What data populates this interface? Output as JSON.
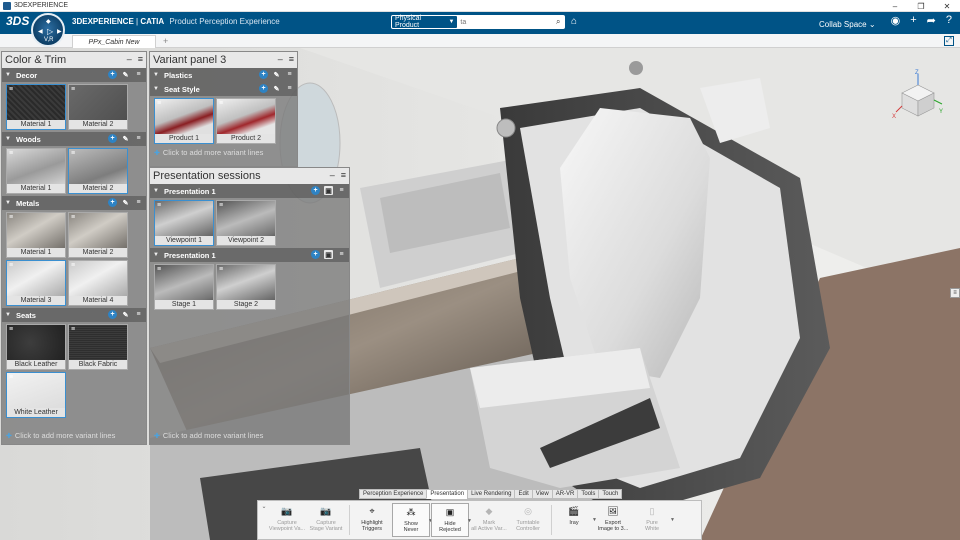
{
  "window": {
    "title": "3DEXPERIENCE",
    "controls": [
      "–",
      "❐",
      "✕"
    ]
  },
  "topbar": {
    "brand_bold": "3DEXPERIENCE",
    "brand_sep": " | ",
    "brand_catia": "CATIA",
    "brand_app": "Product Perception Experience",
    "compass_label": "V,R",
    "search_scope": "Physical Product",
    "search_placeholder": "ta",
    "collab_space": "Collab Space",
    "icons": [
      "user-icon",
      "plus-icon",
      "share-icon",
      "help-icon"
    ]
  },
  "tabs": {
    "doc_tab": "PPx_Cabin New",
    "add": "+"
  },
  "color_trim": {
    "title": "Color & Trim",
    "sections": [
      {
        "name": "Decor",
        "items": [
          {
            "label": "Material 1",
            "swatch": "sw-dark",
            "selected": true
          },
          {
            "label": "Material 2",
            "swatch": "sw-grey"
          }
        ]
      },
      {
        "name": "Woods",
        "items": [
          {
            "label": "Material 1",
            "swatch": "sw-wood1"
          },
          {
            "label": "Material 2",
            "swatch": "sw-wood2",
            "selected": true
          }
        ]
      },
      {
        "name": "Metals",
        "items": [
          {
            "label": "Material 1",
            "swatch": "sw-metal"
          },
          {
            "label": "Material 2",
            "swatch": "sw-metal"
          },
          {
            "label": "Material 3",
            "swatch": "sw-metal2",
            "selected": true
          },
          {
            "label": "Material 4",
            "swatch": "sw-metal2"
          }
        ]
      },
      {
        "name": "Seats",
        "items": [
          {
            "label": "Black Leather",
            "swatch": "sw-leather"
          },
          {
            "label": "Black Fabric",
            "swatch": "sw-fabric"
          },
          {
            "label": "White Leather",
            "swatch": "sw-white",
            "selected": true
          }
        ]
      }
    ],
    "add_line": "Click to add more variant lines"
  },
  "variant_panel": {
    "title": "Variant panel 3",
    "sections": [
      {
        "name": "Plastics",
        "items": []
      },
      {
        "name": "Seat Style",
        "items": [
          {
            "label": "Product 1",
            "swatch": "sw-seat-a",
            "selected": true
          },
          {
            "label": "Product 2",
            "swatch": "sw-seat-b"
          }
        ]
      }
    ],
    "add_line": "Click to add more variant lines"
  },
  "presentation": {
    "title": "Presentation sessions",
    "sections": [
      {
        "name": "Presentation 1",
        "items": [
          {
            "label": "Viewpoint 1",
            "swatch": "sw-cabin",
            "selected": true
          },
          {
            "label": "Viewpoint 2",
            "swatch": "sw-cabin2"
          }
        ]
      },
      {
        "name": "Presentation 1",
        "items": [
          {
            "label": "Stage 1",
            "swatch": "sw-cabin2"
          },
          {
            "label": "Stage 2",
            "swatch": "sw-cabin"
          }
        ]
      }
    ],
    "add_line": "Click to add more variant lines"
  },
  "navcube": {
    "x": "X",
    "y": "Y",
    "z": "Z"
  },
  "action_bar": {
    "tabs": [
      "Perception Experience",
      "Presentation",
      "Live Rendering",
      "Edit",
      "View",
      "AR-VR",
      "Tools",
      "Touch"
    ],
    "active_tab": "Presentation",
    "commands": [
      {
        "l1": "Capture",
        "l2": "Viewpoint Va...",
        "icon": "📷",
        "disabled": true
      },
      {
        "l1": "Capture",
        "l2": "Stage Variant",
        "icon": "📷",
        "disabled": true
      },
      {
        "l1": "Highlight",
        "l2": "Triggers",
        "icon": "⌖",
        "disabled": false
      },
      {
        "l1": "Show",
        "l2": "Never",
        "icon": "⁂",
        "disabled": false,
        "boxed": true,
        "drop": true
      },
      {
        "l1": "Hide",
        "l2": "Rejected",
        "icon": "▣",
        "disabled": false,
        "boxed": true,
        "drop": true
      },
      {
        "l1": "Mark",
        "l2": "all Active Var...",
        "icon": "◆",
        "disabled": true
      },
      {
        "l1": "Turntable",
        "l2": "Controller",
        "icon": "◎",
        "disabled": true
      },
      {
        "l1": "Iray",
        "l2": "",
        "icon": "🎬",
        "disabled": false,
        "drop": true
      },
      {
        "l1": "Export",
        "l2": "Image to 3...",
        "icon": "🖼",
        "disabled": false
      },
      {
        "l1": "Pure",
        "l2": "White",
        "icon": "▯",
        "disabled": true,
        "drop": true
      }
    ]
  }
}
